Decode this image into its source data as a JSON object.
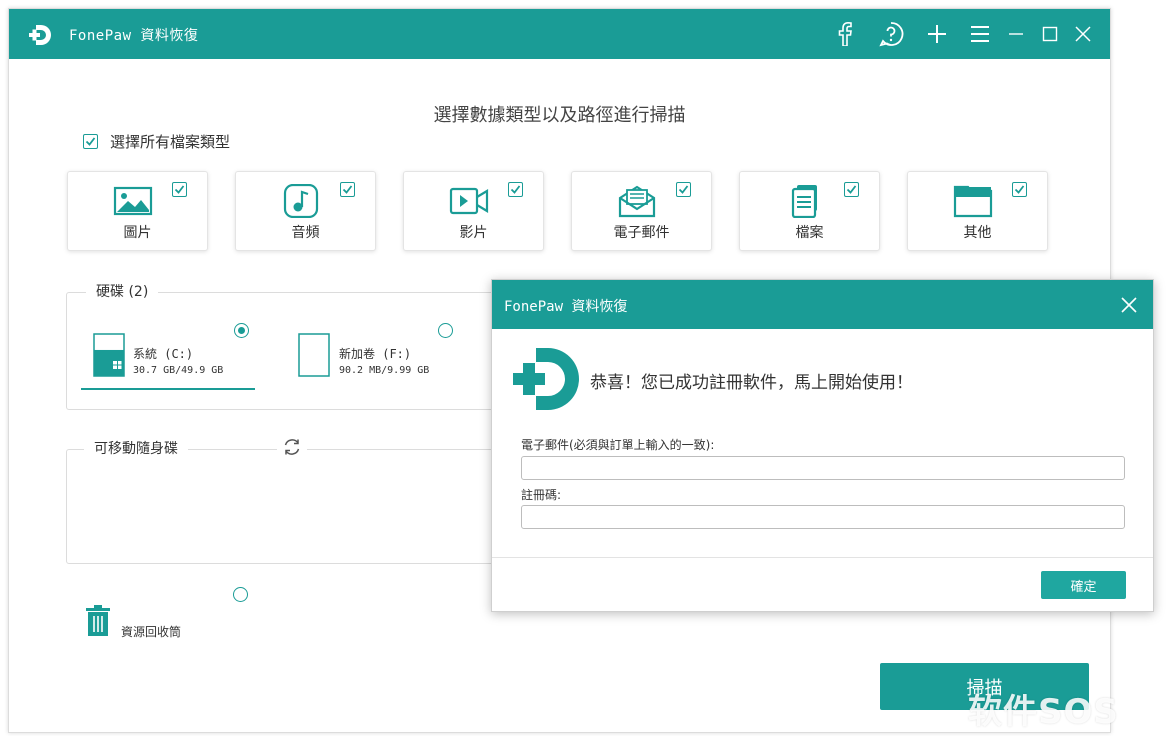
{
  "app": {
    "title": "FonePaw 資料恢復"
  },
  "titlebar_icons": [
    "facebook-icon",
    "help-icon",
    "plus-icon",
    "menu-icon",
    "minimize-icon",
    "maximize-icon",
    "close-icon"
  ],
  "colors": {
    "accent": "#1a9c96",
    "button": "#1fa7a0"
  },
  "main": {
    "heading": "選擇數據類型以及路徑進行掃描",
    "select_all_label": "選擇所有檔案類型",
    "select_all_checked": true,
    "file_types": [
      {
        "label": "圖片",
        "icon": "image-icon",
        "checked": true
      },
      {
        "label": "音頻",
        "icon": "audio-icon",
        "checked": true
      },
      {
        "label": "影片",
        "icon": "video-icon",
        "checked": true
      },
      {
        "label": "電子郵件",
        "icon": "email-icon",
        "checked": true
      },
      {
        "label": "檔案",
        "icon": "document-icon",
        "checked": true
      },
      {
        "label": "其他",
        "icon": "folder-icon",
        "checked": true
      }
    ],
    "hard_disk_group": {
      "label": "硬碟 (2)",
      "drives": [
        {
          "name": "系統 (C:)",
          "size": "30.7 GB/49.9 GB",
          "selected": true,
          "usage_fraction": 0.62
        },
        {
          "name": "新加卷 (F:)",
          "size": "90.2 MB/9.99 GB",
          "selected": false,
          "usage_fraction": 0.01
        }
      ]
    },
    "removable_group": {
      "label": "可移動隨身碟"
    },
    "recycle_bin": {
      "label": "資源回收筒",
      "selected": false
    },
    "scan_button": "掃描"
  },
  "dialog": {
    "title": "FonePaw 資料恢復",
    "message": "恭喜！您已成功註冊軟件，馬上開始使用！",
    "email_label": "電子郵件(必須與訂單上輸入的一致):",
    "email_value": "",
    "code_label": "註冊碼:",
    "code_value": "",
    "ok_button": "確定"
  },
  "watermark": "软件SOS"
}
